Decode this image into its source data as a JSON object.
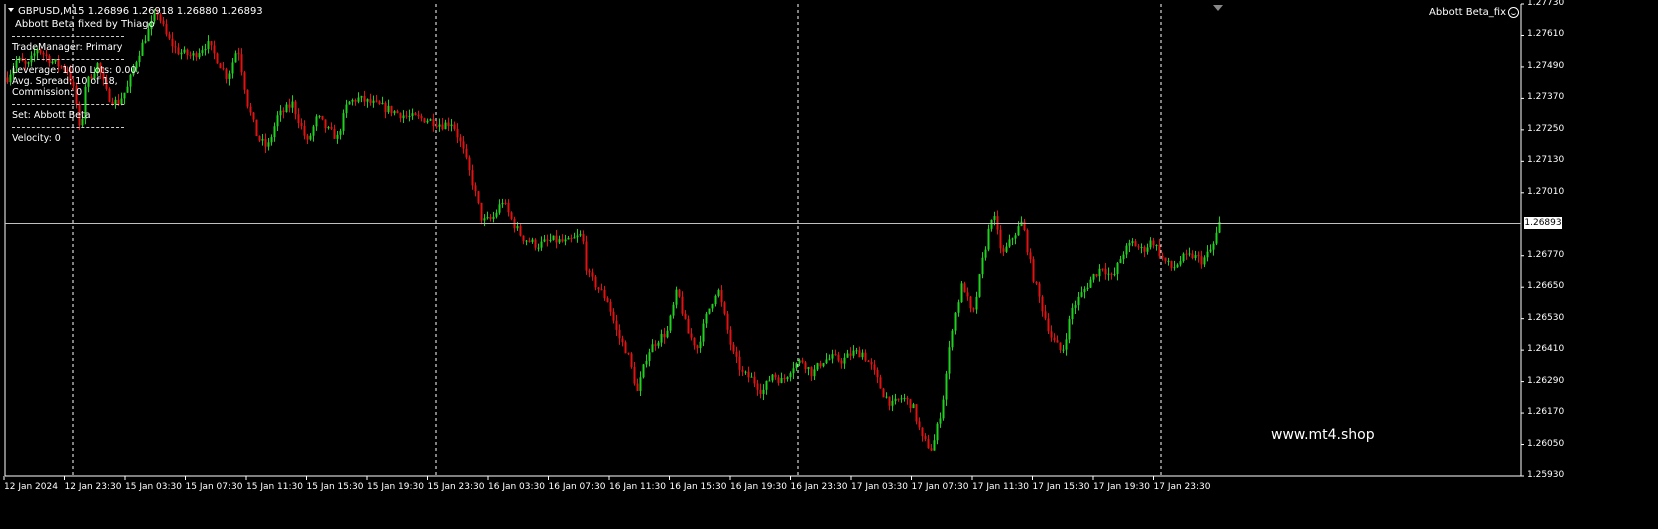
{
  "header": {
    "symbol_line": "GBPUSD,M15  1.26896 1.26918 1.26880 1.26893",
    "ea_title": "Abbott Beta fixed by Thiago"
  },
  "info_panel": {
    "trade_manager": "TradeManager: Primary",
    "leverage": "Leverage: 1000 Lots: 0.00,",
    "spread": "Avg. Spread: 10 of 18,",
    "commission": "Commission: 0",
    "set": "Set: Abbott Beta",
    "velocity": "Velocity: 0"
  },
  "indicator_label": "Abbott Beta_fix",
  "watermark": "www.mt4.shop",
  "price_axis": [
    "1.27730",
    "1.27610",
    "1.27490",
    "1.27370",
    "1.27250",
    "1.27130",
    "1.27010",
    "1.26893",
    "1.26770",
    "1.26650",
    "1.26530",
    "1.26410",
    "1.26290",
    "1.26170",
    "1.26050",
    "1.25930"
  ],
  "current_price": "1.26893",
  "time_axis": [
    "12 Jan 2024",
    "12 Jan 23:30",
    "15 Jan 03:30",
    "15 Jan 07:30",
    "15 Jan 11:30",
    "15 Jan 15:30",
    "15 Jan 19:30",
    "15 Jan 23:30",
    "16 Jan 03:30",
    "16 Jan 07:30",
    "16 Jan 11:30",
    "16 Jan 15:30",
    "16 Jan 19:30",
    "16 Jan 23:30",
    "17 Jan 03:30",
    "17 Jan 07:30",
    "17 Jan 11:30",
    "17 Jan 15:30",
    "17 Jan 19:30",
    "17 Jan 23:30"
  ],
  "colors": {
    "bull": "#1fd11f",
    "bear": "#e31212",
    "background": "#000000",
    "grid": "#ffffff"
  },
  "chart_data": {
    "type": "candlestick",
    "symbol": "GBPUSD",
    "timeframe": "M15",
    "ylim": [
      1.2593,
      1.2773
    ],
    "current_price": 1.26893,
    "path": [
      [
        0,
        1.2745
      ],
      [
        10,
        1.2752
      ],
      [
        20,
        1.2749
      ],
      [
        30,
        1.2756
      ],
      [
        45,
        1.2751
      ],
      [
        60,
        1.2748
      ],
      [
        68,
        1.2738
      ],
      [
        73,
        1.2722
      ],
      [
        78,
        1.2742
      ],
      [
        90,
        1.275
      ],
      [
        100,
        1.2738
      ],
      [
        110,
        1.2735
      ],
      [
        120,
        1.2741
      ],
      [
        130,
        1.2753
      ],
      [
        140,
        1.2762
      ],
      [
        150,
        1.277
      ],
      [
        160,
        1.276
      ],
      [
        170,
        1.2755
      ],
      [
        185,
        1.2753
      ],
      [
        200,
        1.2758
      ],
      [
        210,
        1.2752
      ],
      [
        220,
        1.2745
      ],
      [
        230,
        1.2757
      ],
      [
        240,
        1.2735
      ],
      [
        250,
        1.2722
      ],
      [
        260,
        1.2718
      ],
      [
        270,
        1.273
      ],
      [
        285,
        1.2735
      ],
      [
        300,
        1.272
      ],
      [
        310,
        1.273
      ],
      [
        320,
        1.2725
      ],
      [
        330,
        1.2722
      ],
      [
        340,
        1.2735
      ],
      [
        350,
        1.2737
      ],
      [
        365,
        1.2735
      ],
      [
        380,
        1.2733
      ],
      [
        400,
        1.273
      ],
      [
        420,
        1.2729
      ],
      [
        435,
        1.2727
      ],
      [
        445,
        1.2728
      ],
      [
        455,
        1.2718
      ],
      [
        465,
        1.2705
      ],
      [
        475,
        1.269
      ],
      [
        485,
        1.2691
      ],
      [
        495,
        1.2698
      ],
      [
        505,
        1.269
      ],
      [
        515,
        1.2684
      ],
      [
        530,
        1.2681
      ],
      [
        545,
        1.2683
      ],
      [
        560,
        1.2682
      ],
      [
        575,
        1.2685
      ],
      [
        580,
        1.267
      ],
      [
        590,
        1.2665
      ],
      [
        600,
        1.266
      ],
      [
        610,
        1.2647
      ],
      [
        620,
        1.264
      ],
      [
        630,
        1.2625
      ],
      [
        640,
        1.264
      ],
      [
        650,
        1.2645
      ],
      [
        660,
        1.2648
      ],
      [
        670,
        1.2664
      ],
      [
        680,
        1.2648
      ],
      [
        690,
        1.2642
      ],
      [
        700,
        1.2655
      ],
      [
        710,
        1.2665
      ],
      [
        718,
        1.2652
      ],
      [
        725,
        1.264
      ],
      [
        735,
        1.2632
      ],
      [
        745,
        1.263
      ],
      [
        755,
        1.2625
      ],
      [
        765,
        1.2632
      ],
      [
        775,
        1.2629
      ],
      [
        785,
        1.2635
      ],
      [
        795,
        1.2637
      ],
      [
        805,
        1.2632
      ],
      [
        815,
        1.2637
      ],
      [
        825,
        1.2638
      ],
      [
        835,
        1.2637
      ],
      [
        845,
        1.264
      ],
      [
        855,
        1.264
      ],
      [
        865,
        1.2634
      ],
      [
        875,
        1.2625
      ],
      [
        885,
        1.262
      ],
      [
        895,
        1.2623
      ],
      [
        905,
        1.262
      ],
      [
        915,
        1.2607
      ],
      [
        925,
        1.2603
      ],
      [
        935,
        1.262
      ],
      [
        945,
        1.265
      ],
      [
        955,
        1.2667
      ],
      [
        965,
        1.2653
      ],
      [
        975,
        1.2675
      ],
      [
        985,
        1.2694
      ],
      [
        995,
        1.2677
      ],
      [
        1005,
        1.2684
      ],
      [
        1015,
        1.269
      ],
      [
        1025,
        1.267
      ],
      [
        1035,
        1.2657
      ],
      [
        1045,
        1.2645
      ],
      [
        1055,
        1.264
      ],
      [
        1065,
        1.2657
      ],
      [
        1075,
        1.2663
      ],
      [
        1085,
        1.2669
      ],
      [
        1095,
        1.2673
      ],
      [
        1105,
        1.2668
      ],
      [
        1115,
        1.2678
      ],
      [
        1125,
        1.2682
      ],
      [
        1135,
        1.2679
      ],
      [
        1145,
        1.2683
      ],
      [
        1155,
        1.2676
      ],
      [
        1165,
        1.2672
      ],
      [
        1175,
        1.2676
      ],
      [
        1185,
        1.2677
      ],
      [
        1195,
        1.2675
      ],
      [
        1205,
        1.268
      ],
      [
        1212,
        1.2689
      ]
    ]
  }
}
